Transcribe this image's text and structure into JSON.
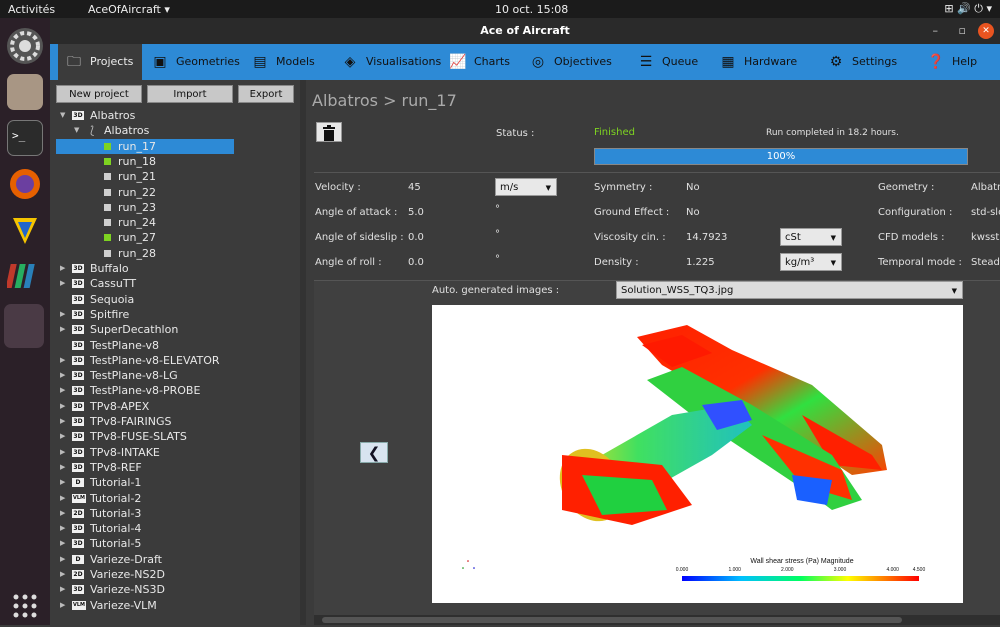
{
  "topbar": {
    "activities": "Activités",
    "app": "AceOfAircraft ▾",
    "clock": "10 oct.  15:08",
    "sys": "⊞  🔊  ⏻ ▾"
  },
  "window": {
    "title": "Ace of Aircraft",
    "min": "–",
    "max": "▫",
    "close": "✕"
  },
  "tabs": [
    {
      "label": "Projects",
      "icon": "folder-icon"
    },
    {
      "label": "Geometries",
      "icon": "geometry-icon"
    },
    {
      "label": "Models",
      "icon": "models-icon"
    },
    {
      "label": "Visualisations",
      "icon": "visualisation-icon"
    },
    {
      "label": "Charts",
      "icon": "chart-icon"
    },
    {
      "label": "Objectives",
      "icon": "target-icon"
    },
    {
      "label": "Queue",
      "icon": "queue-icon"
    },
    {
      "label": "Hardware",
      "icon": "hardware-icon"
    },
    {
      "label": "Settings",
      "icon": "gear-icon"
    },
    {
      "label": "Help",
      "icon": "help-icon"
    }
  ],
  "left": {
    "new_project": "New project",
    "import": "Import",
    "export": "Export"
  },
  "tree": [
    {
      "label": "Albatros",
      "badge": "3D",
      "level": 0,
      "arrow": "▼"
    },
    {
      "label": "Albatros",
      "badge": "",
      "level": 1,
      "arrow": "▼",
      "icon": "branch-icon"
    },
    {
      "label": "run_17",
      "level": 2,
      "status": "green",
      "selected": true
    },
    {
      "label": "run_18",
      "level": 2,
      "status": "green"
    },
    {
      "label": "run_21",
      "level": 2,
      "status": "grey"
    },
    {
      "label": "run_22",
      "level": 2,
      "status": "grey"
    },
    {
      "label": "run_23",
      "level": 2,
      "status": "grey"
    },
    {
      "label": "run_24",
      "level": 2,
      "status": "grey"
    },
    {
      "label": "run_27",
      "level": 2,
      "status": "green"
    },
    {
      "label": "run_28",
      "level": 2,
      "status": "grey"
    },
    {
      "label": "Buffalo",
      "badge": "3D",
      "level": 0,
      "arrow": "▶"
    },
    {
      "label": "CassuTT",
      "badge": "3D",
      "level": 0,
      "arrow": "▶"
    },
    {
      "label": "Sequoia",
      "badge": "3D",
      "level": 0,
      "arrow": ""
    },
    {
      "label": "Spitfire",
      "badge": "3D",
      "level": 0,
      "arrow": "▶"
    },
    {
      "label": "SuperDecathlon",
      "badge": "3D",
      "level": 0,
      "arrow": "▶"
    },
    {
      "label": "TestPlane-v8",
      "badge": "3D",
      "level": 0,
      "arrow": ""
    },
    {
      "label": "TestPlane-v8-ELEVATOR",
      "badge": "3D",
      "level": 0,
      "arrow": "▶"
    },
    {
      "label": "TestPlane-v8-LG",
      "badge": "3D",
      "level": 0,
      "arrow": "▶"
    },
    {
      "label": "TestPlane-v8-PROBE",
      "badge": "3D",
      "level": 0,
      "arrow": "▶"
    },
    {
      "label": "TPv8-APEX",
      "badge": "3D",
      "level": 0,
      "arrow": "▶"
    },
    {
      "label": "TPv8-FAIRINGS",
      "badge": "3D",
      "level": 0,
      "arrow": "▶"
    },
    {
      "label": "TPv8-FUSE-SLATS",
      "badge": "3D",
      "level": 0,
      "arrow": "▶"
    },
    {
      "label": "TPv8-INTAKE",
      "badge": "3D",
      "level": 0,
      "arrow": "▶"
    },
    {
      "label": "TPv8-REF",
      "badge": "3D",
      "level": 0,
      "arrow": "▶"
    },
    {
      "label": "Tutorial-1",
      "badge": "D",
      "level": 0,
      "arrow": "▶"
    },
    {
      "label": "Tutorial-2",
      "badge": "VLM",
      "level": 0,
      "arrow": "▶"
    },
    {
      "label": "Tutorial-3",
      "badge": "2D",
      "level": 0,
      "arrow": "▶"
    },
    {
      "label": "Tutorial-4",
      "badge": "3D",
      "level": 0,
      "arrow": "▶"
    },
    {
      "label": "Tutorial-5",
      "badge": "3D",
      "level": 0,
      "arrow": "▶"
    },
    {
      "label": "Varieze-Draft",
      "badge": "D",
      "level": 0,
      "arrow": "▶"
    },
    {
      "label": "Varieze-NS2D",
      "badge": "2D",
      "level": 0,
      "arrow": "▶"
    },
    {
      "label": "Varieze-NS3D",
      "badge": "3D",
      "level": 0,
      "arrow": "▶"
    },
    {
      "label": "Varieze-VLM",
      "badge": "VLM",
      "level": 0,
      "arrow": "▶"
    }
  ],
  "main": {
    "breadcrumb": "Albatros > run_17",
    "status_label": "Status :",
    "status_value": "Finished",
    "status_message": "Run completed in 18.2 hours.",
    "progress_pct": 100,
    "progress_text": "100%",
    "velocity_label": "Velocity :",
    "velocity_value": "45",
    "velocity_unit": "m/s",
    "aoa_label": "Angle of attack :",
    "aoa_value": "5.0",
    "aoa_unit": "°",
    "sideslip_label": "Angle of sideslip :",
    "sideslip_value": "0.0",
    "sideslip_unit": "°",
    "roll_label": "Angle of roll :",
    "roll_value": "0.0",
    "roll_unit": "°",
    "symmetry_label": "Symmetry :",
    "symmetry_value": "No",
    "ground_label": "Ground Effect :",
    "ground_value": "No",
    "visc_label": "Viscosity cin. :",
    "visc_value": "14.7923",
    "visc_unit": "cSt",
    "density_label": "Density :",
    "density_value": "1.225",
    "density_unit": "kg/m³",
    "geometry_label": "Geometry :",
    "geometry_value": "Albatr",
    "config_label": "Configuration :",
    "config_value": "std-slo",
    "cfd_label": "CFD models :",
    "cfd_value": "kwsst",
    "temporal_label": "Temporal mode :",
    "temporal_value": "Steady",
    "images_label": "Auto. generated images :",
    "images_value": "Solution_WSS_TQ3.jpg",
    "colorbar_title": "Wall shear stress (Pa) Magnitude",
    "colorbar_ticks": [
      "0.000",
      "1.000",
      "2.000",
      "3.000",
      "4.000",
      "4.500"
    ]
  },
  "colors": {
    "accent": "#2d8ad6",
    "finished": "#7ed321"
  }
}
